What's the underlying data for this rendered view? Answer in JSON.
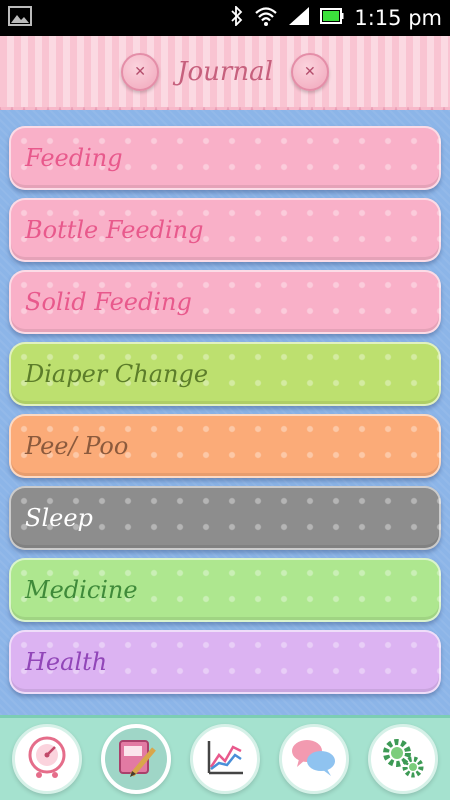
{
  "status_bar": {
    "time": "1:15 pm",
    "icons": [
      "image-icon",
      "bluetooth-icon",
      "wifi-icon",
      "signal-icon",
      "battery-icon"
    ]
  },
  "header": {
    "title": "Journal"
  },
  "journal_items": [
    {
      "label": "Feeding",
      "color": "#f9b0c8"
    },
    {
      "label": "Bottle Feeding",
      "color": "#f9b0c8"
    },
    {
      "label": "Solid Feeding",
      "color": "#f9b0c8"
    },
    {
      "label": "Diaper Change",
      "color": "#bde06f"
    },
    {
      "label": "Pee/ Poo",
      "color": "#fbab78"
    },
    {
      "label": "Sleep",
      "color": "#8d8d8d"
    },
    {
      "label": "Medicine",
      "color": "#aee78f"
    },
    {
      "label": "Health",
      "color": "#dcb3f2"
    }
  ],
  "bottom_nav": {
    "items": [
      {
        "icon": "gauge-icon"
      },
      {
        "icon": "journal-pencil-icon",
        "active": true
      },
      {
        "icon": "chart-icon"
      },
      {
        "icon": "chat-bubbles-icon"
      },
      {
        "icon": "gears-icon"
      }
    ]
  },
  "colors": {
    "background": "#8cb5e8",
    "header": "#f9c4d2",
    "nav": "#a5e2cf"
  }
}
